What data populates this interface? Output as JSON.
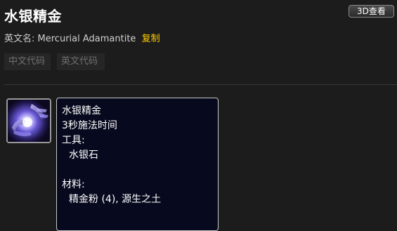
{
  "header": {
    "title": "水银精金",
    "view_3d_label": "3D查看"
  },
  "english_name": {
    "label": "英文名:",
    "value": "Mercurial Adamantite",
    "copy_label": "复制"
  },
  "code_tabs": [
    {
      "label": "中文代码"
    },
    {
      "label": "英文代码"
    }
  ],
  "tooltip": {
    "name": "水银精金",
    "cast_time": "3秒施法时间",
    "tools_label": "工具:",
    "tool": "水银石",
    "reagents_label": "材料:",
    "reagents": "精金粉 (4), 源生之土"
  },
  "colors": {
    "background": "#1c1c1c",
    "copy_link": "#ffcc00",
    "tooltip_background": "#070a1e"
  },
  "icons": {
    "spell_icon": "mercurial-adamantite-spell-icon"
  }
}
